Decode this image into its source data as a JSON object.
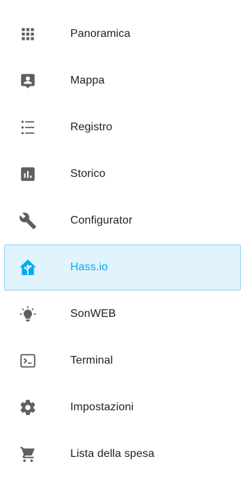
{
  "sidebar": {
    "icon_color": "#5f5f5f",
    "active_color": "#03a9f4",
    "items": [
      {
        "label": "Panoramica",
        "icon": "apps-grid-icon"
      },
      {
        "label": "Mappa",
        "icon": "account-box-icon"
      },
      {
        "label": "Registro",
        "icon": "format-list-bulleted-icon"
      },
      {
        "label": "Storico",
        "icon": "chart-box-icon"
      },
      {
        "label": "Configurator",
        "icon": "wrench-icon"
      },
      {
        "label": "Hass.io",
        "icon": "home-assistant-icon",
        "selected": true
      },
      {
        "label": "SonWEB",
        "icon": "lightbulb-on-icon"
      },
      {
        "label": "Terminal",
        "icon": "console-icon"
      },
      {
        "label": "Impostazioni",
        "icon": "gear-icon"
      },
      {
        "label": "Lista della spesa",
        "icon": "cart-icon"
      }
    ]
  }
}
